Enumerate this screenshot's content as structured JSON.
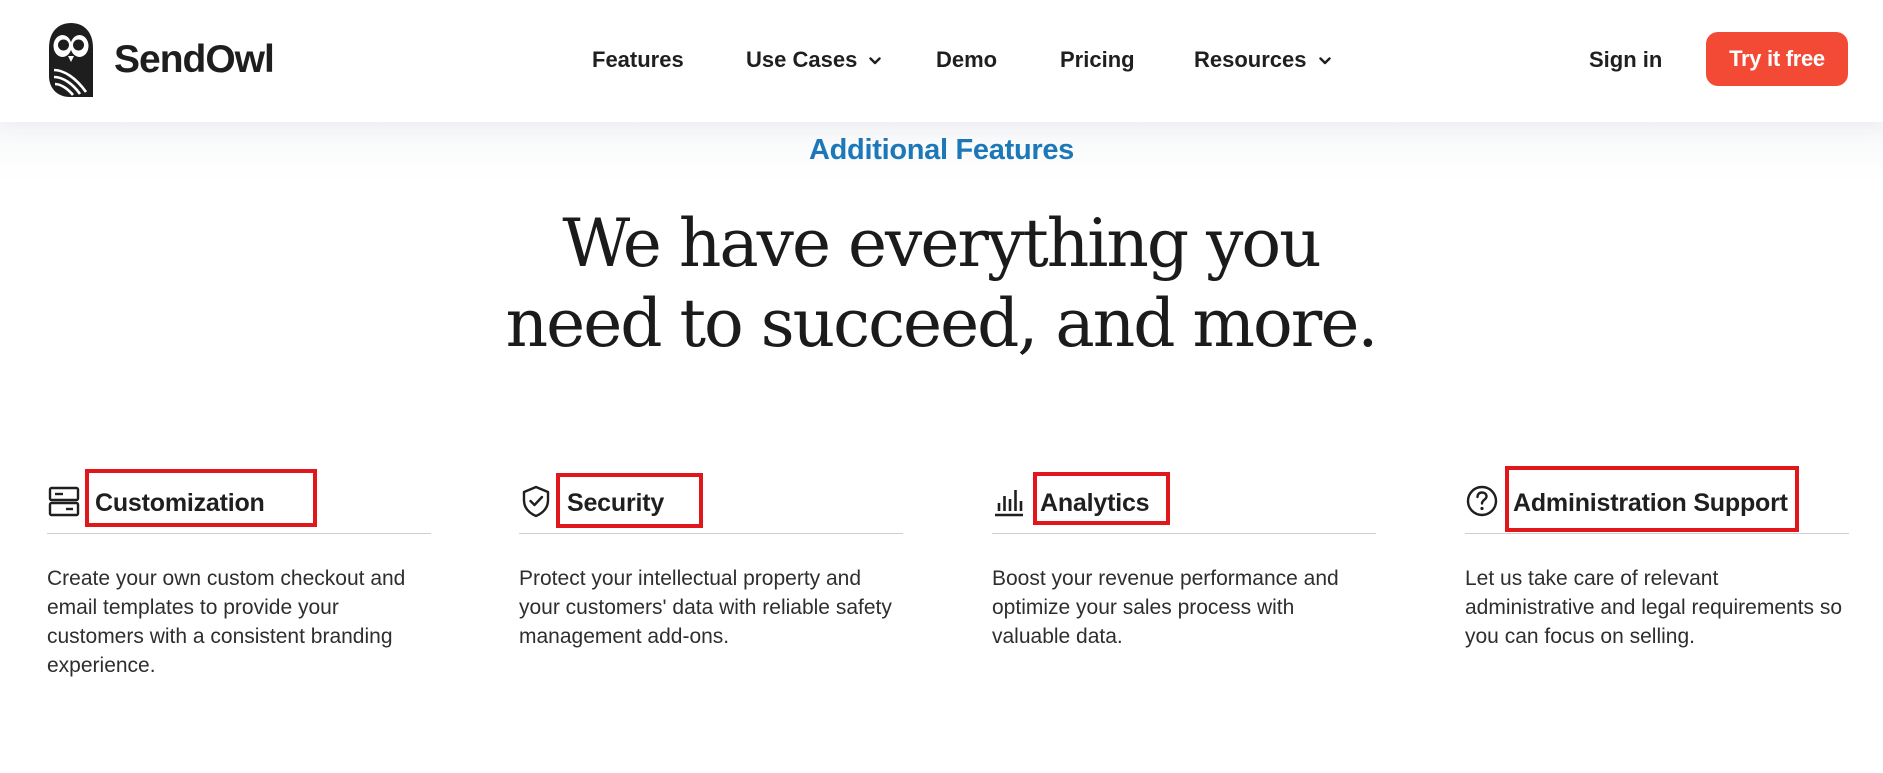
{
  "header": {
    "logo_text": "SendOwl",
    "nav": {
      "features": "Features",
      "use_cases": "Use Cases",
      "demo": "Demo",
      "pricing": "Pricing",
      "resources": "Resources"
    },
    "sign_in": "Sign in",
    "cta": "Try it free"
  },
  "hero": {
    "eyebrow": "Additional Features",
    "headline_line1": "We have everything you",
    "headline_line2": "need to succeed, and more."
  },
  "features": [
    {
      "title": "Customization",
      "icon": "layout-icon",
      "description": "Create your own custom checkout and email templates to provide your customers with a consistent branding experience."
    },
    {
      "title": "Security",
      "icon": "shield-check-icon",
      "description": "Protect your intellectual property and your customers' data with reliable safety management add-ons."
    },
    {
      "title": "Analytics",
      "icon": "bar-chart-icon",
      "description": "Boost your revenue performance and optimize your sales process with valuable data."
    },
    {
      "title": "Administration Support",
      "icon": "question-circle-icon",
      "description": "Let us take care of relevant administrative and legal requirements so you can focus on selling."
    }
  ],
  "colors": {
    "cta_background": "#f24a35",
    "eyebrow": "#1c78b8",
    "highlight_box": "#e0171b"
  }
}
